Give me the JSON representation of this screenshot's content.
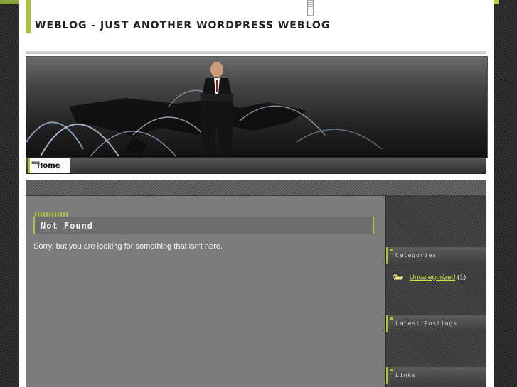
{
  "site": {
    "title": "WEBLOG - JUST ANOTHER WORDPRESS WEBLOG"
  },
  "nav": {
    "items": [
      {
        "label": "Home"
      }
    ]
  },
  "post": {
    "title": "Not Found",
    "text": "Sorry, but you are looking for something that isn't here."
  },
  "sidebar": {
    "categories": {
      "title": "Categories",
      "items": [
        {
          "label": "Uncategorized",
          "count": "(1)"
        }
      ]
    },
    "latest": {
      "title": "Latest Postings"
    },
    "links": {
      "title": "Links"
    }
  },
  "colors": {
    "accent": "#a8c23a",
    "link": "#c9e24a"
  },
  "icons": {
    "folder": "folder-icon"
  }
}
